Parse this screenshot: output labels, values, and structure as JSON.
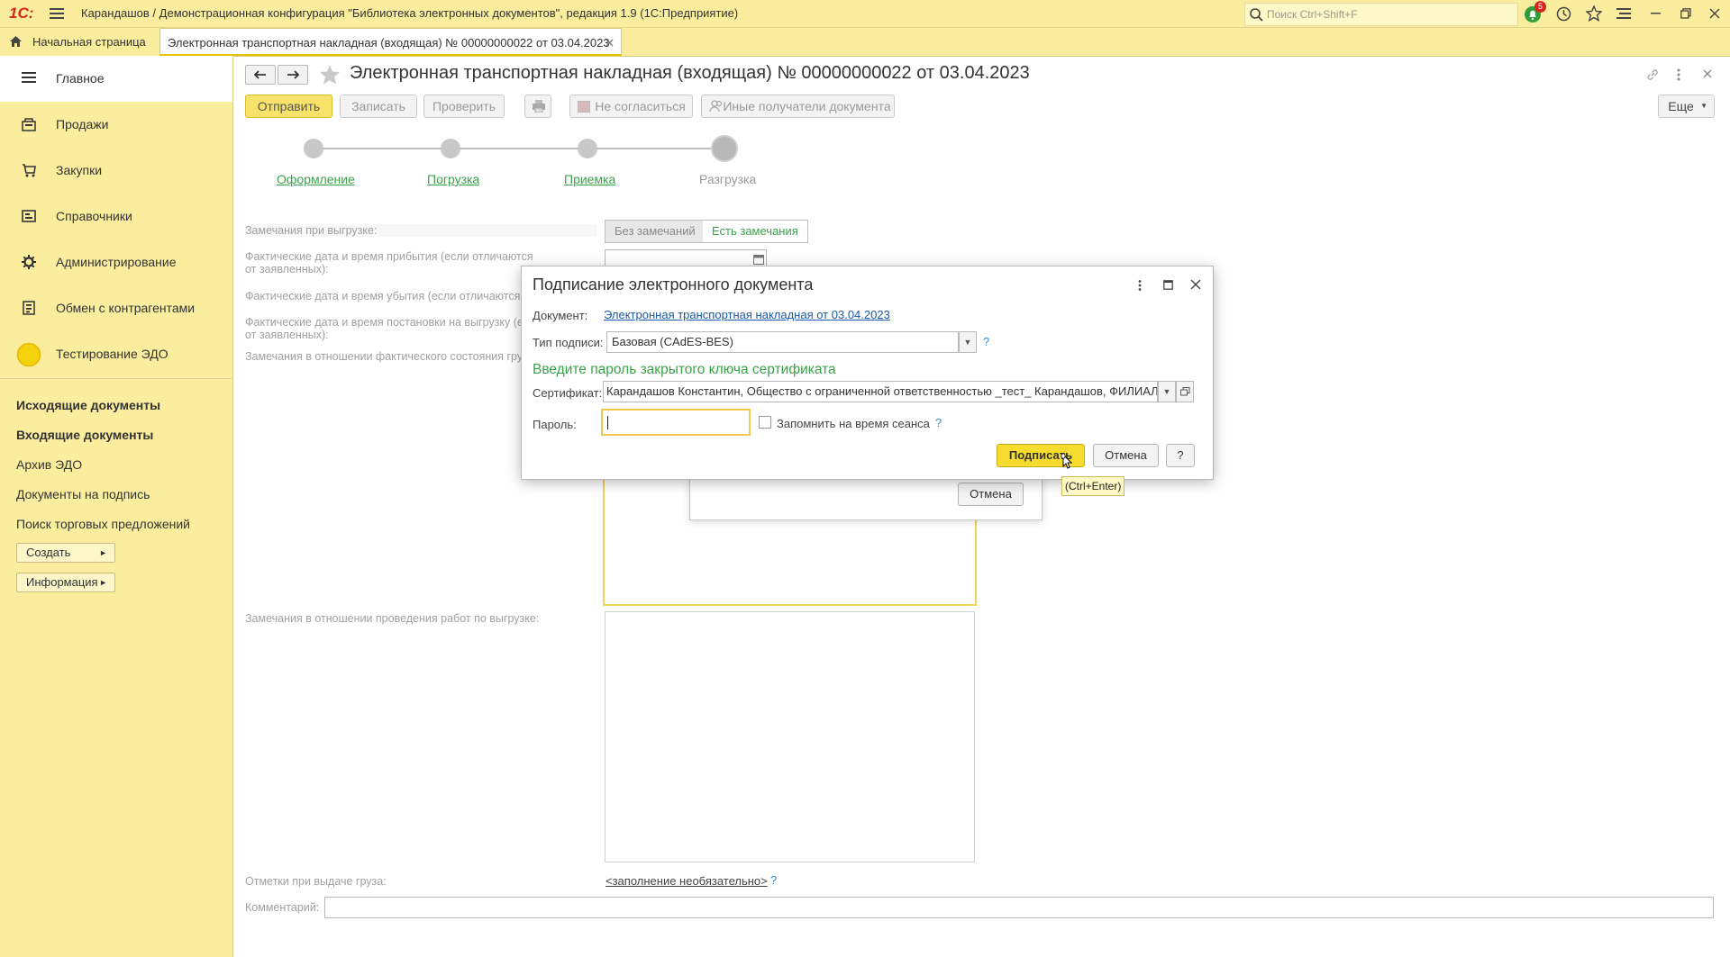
{
  "app": {
    "logo": "1С:",
    "window_title": "Карандашов / Демонстрационная конфигурация \"Библиотека электронных документов\", редакция 1.9  (1С:Предприятие)",
    "search_placeholder": "Поиск Ctrl+Shift+F",
    "notification_count": "5",
    "accent_color": "#fbed9e"
  },
  "tabs": [
    {
      "label": "Начальная страница"
    },
    {
      "label": "Электронная транспортная накладная (входящая) № 00000000022 от 03.04.2023"
    }
  ],
  "sidebar": {
    "sections": [
      {
        "label": "Главное",
        "icon": "menu-icon"
      },
      {
        "label": "Продажи",
        "icon": "sales-icon"
      },
      {
        "label": "Закупки",
        "icon": "purchases-icon"
      },
      {
        "label": "Справочники",
        "icon": "catalogs-icon"
      },
      {
        "label": "Администрирование",
        "icon": "gear-icon"
      },
      {
        "label": "Обмен с контрагентами",
        "icon": "exchange-icon"
      },
      {
        "label": "Тестирование ЭДО",
        "icon": "test-icon"
      }
    ],
    "nav_items": [
      {
        "label": "Исходящие документы"
      },
      {
        "label": "Входящие документы"
      },
      {
        "label": "Архив ЭДО"
      },
      {
        "label": "Документы на подпись"
      },
      {
        "label": "Поиск торговых предложений"
      }
    ],
    "create_button": "Создать",
    "info_button": "Информация"
  },
  "form": {
    "title": "Электронная транспортная накладная (входящая) № 00000000022 от 03.04.2023",
    "toolbar": {
      "send": "Отправить",
      "save": "Записать",
      "check": "Проверить",
      "disagree": "Не согласиться",
      "other_recipients": "Иные получатели документа",
      "more": "Еще"
    },
    "steps": [
      {
        "label": "Оформление"
      },
      {
        "label": "Погрузка"
      },
      {
        "label": "Приемка"
      },
      {
        "label": "Разгрузка"
      }
    ],
    "fields": {
      "unload_remarks": "Замечания при выгрузке:",
      "no_remarks": "Без замечаний",
      "has_remarks": "Есть замечания",
      "arrival": "Фактические дата и время прибытия (если отличаются от заявленных):",
      "departure": "Фактические дата и время убытия (если отличаются о",
      "placement": "Фактические дата и время постановки на выгрузку (ес от заявленных):",
      "cargo_state": "Замечания в отношении фактического состояния груз",
      "work_remarks": "Замечания в отношении проведения работ по выгрузке:",
      "issue_marks": "Отметки при выдаче груза:",
      "optional_link": "<заполнение необязательно>",
      "help": "?",
      "comment": "Комментарий:"
    }
  },
  "behind_dialog": {
    "cancel": "Отмена"
  },
  "dialog": {
    "title": "Подписание электронного документа",
    "document_label": "Документ:",
    "document_link": "Электронная транспортная накладная от 03.04.2023",
    "sig_type_label": "Тип подписи:",
    "sig_type_value": "Базовая (CAdES-BES)",
    "help": "?",
    "prompt": "Введите пароль закрытого ключа сертификата",
    "cert_label": "Сертификат:",
    "cert_value": "Карандашов Константин, Общество с ограниченной ответственностью _тест_ Карандашов, ФИЛИАЛ",
    "password_label": "Пароль:",
    "password_value": "",
    "remember_label": "Запомнить на время сеанса",
    "remember_checked": false,
    "sign_button": "Подписать",
    "cancel_button": "Отмена",
    "help_button": "?",
    "tooltip": "(Ctrl+Enter)"
  }
}
